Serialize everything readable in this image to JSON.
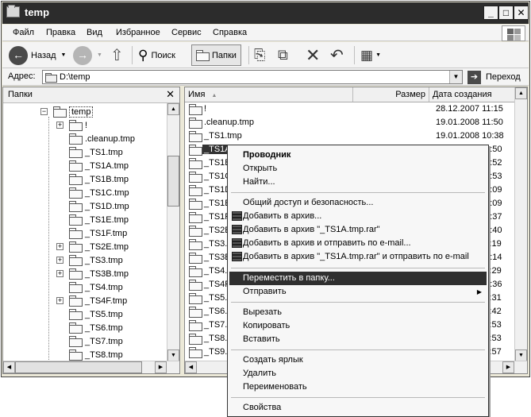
{
  "window": {
    "title": "temp"
  },
  "menu": [
    "Файл",
    "Правка",
    "Вид",
    "Избранное",
    "Сервис",
    "Справка"
  ],
  "toolbar": {
    "back_label": "Назад",
    "search_label": "Поиск",
    "folders_label": "Папки"
  },
  "address": {
    "label": "Адрес:",
    "value": "D:\\temp",
    "go_label": "Переход"
  },
  "left_pane": {
    "header": "Папки",
    "close": "✕",
    "root": "temp",
    "items": [
      "!",
      ".cleanup.tmp",
      "_TS1.tmp",
      "_TS1A.tmp",
      "_TS1B.tmp",
      "_TS1C.tmp",
      "_TS1D.tmp",
      "_TS1E.tmp",
      "_TS1F.tmp",
      "_TS2E.tmp",
      "_TS3.tmp",
      "_TS3B.tmp",
      "_TS4.tmp",
      "_TS4F.tmp",
      "_TS5.tmp",
      "_TS6.tmp",
      "_TS7.tmp",
      "_TS8.tmp"
    ]
  },
  "columns": {
    "name": "Имя",
    "size": "Размер",
    "date": "Дата создания"
  },
  "files": [
    {
      "name": "!",
      "date": "28.12.2007 11:15"
    },
    {
      "name": ".cleanup.tmp",
      "date": "19.01.2008 11:50"
    },
    {
      "name": "_TS1.tmp",
      "date": "19.01.2008 10:38"
    },
    {
      "name": "_TS1A",
      "date": "12:50"
    },
    {
      "name": "_TS1B",
      "date": "12:52"
    },
    {
      "name": "_TS1C",
      "date": "12:53"
    },
    {
      "name": "_TS1D",
      "date": "13:09"
    },
    {
      "name": "_TS1E",
      "date": "13:09"
    },
    {
      "name": "_TS1F",
      "date": "13:37"
    },
    {
      "name": "_TS2E",
      "date": "13:40"
    },
    {
      "name": "_TS3.t",
      "date": "11:19"
    },
    {
      "name": "_TS3B",
      "date": "14:14"
    },
    {
      "name": "_TS4.t",
      "date": "11:29"
    },
    {
      "name": "_TS4F",
      "date": "12:36"
    },
    {
      "name": "_TS5.t",
      "date": "11:31"
    },
    {
      "name": "_TS6.t",
      "date": "11:42"
    },
    {
      "name": "_TS7.t",
      "date": "11:53"
    },
    {
      "name": "_TS8.t",
      "date": "11:53"
    },
    {
      "name": "_TS9.t",
      "date": "11:57"
    }
  ],
  "context_menu": {
    "explorer": "Проводник",
    "open": "Открыть",
    "find": "Найти...",
    "sharing": "Общий доступ и безопасность...",
    "add_archive": "Добавить в архив...",
    "add_rar": "Добавить в архив \"_TS1A.tmp.rar\"",
    "add_email": "Добавить в архив и отправить по e-mail...",
    "add_rar_email": "Добавить в архив \"_TS1A.tmp.rar\" и отправить по e-mail",
    "move_to": "Переместить в папку...",
    "send_to": "Отправить",
    "cut": "Вырезать",
    "copy": "Копировать",
    "paste": "Вставить",
    "shortcut": "Создать ярлык",
    "delete": "Удалить",
    "rename": "Переименовать",
    "properties": "Свойства"
  }
}
